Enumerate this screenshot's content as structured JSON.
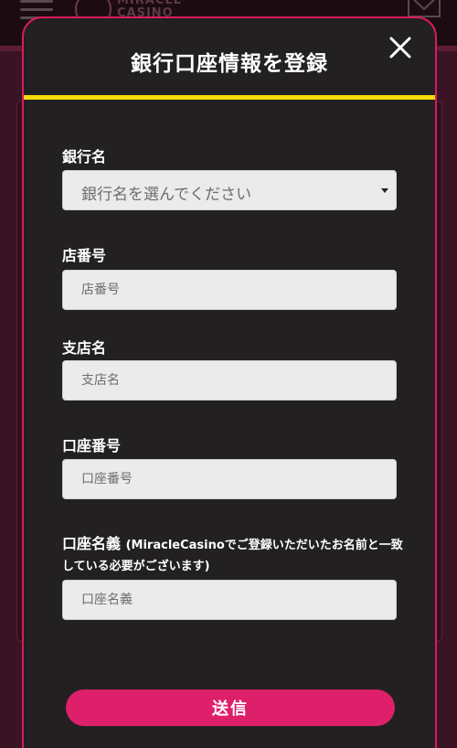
{
  "background": {
    "logo_text": "MIRACLE\nCASINO"
  },
  "modal": {
    "title": "銀行口座情報を登録",
    "fields": [
      {
        "label": "銀行名",
        "type": "select",
        "selected": "銀行名を選んでください"
      },
      {
        "label": "店番号",
        "type": "text",
        "placeholder": "店番号",
        "value": ""
      },
      {
        "label": "支店名",
        "type": "text",
        "placeholder": "支店名",
        "value": ""
      },
      {
        "label": "口座番号",
        "type": "text",
        "placeholder": "口座番号",
        "value": ""
      },
      {
        "label": "口座名義",
        "note_line1": "(MiracleCasinoでご登録いただいたお名前と一致",
        "note_line2": "している必要がございます)",
        "type": "text",
        "placeholder": "口座名義",
        "value": ""
      }
    ],
    "submit_label": "送信"
  },
  "colors": {
    "accent_pink": "#de1f6a",
    "modal_border": "#d81b60",
    "header_underline": "#f5d90a",
    "modal_bg": "#222020"
  },
  "icons": [
    "hamburger-menu-icon",
    "logo-icon",
    "mail-icon",
    "close-icon",
    "chevron-down-icon"
  ]
}
